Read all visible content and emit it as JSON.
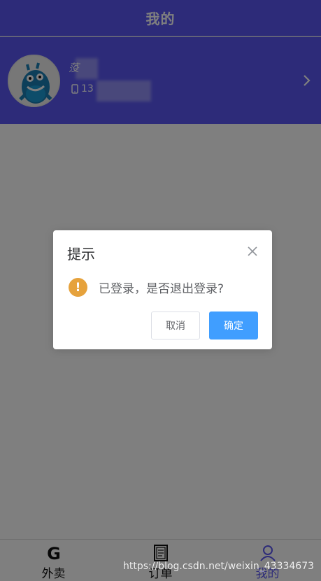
{
  "header": {
    "title": "我的"
  },
  "profile": {
    "name_partial": "莈",
    "phone_partial": "13",
    "avatar": "blue-monster-avatar"
  },
  "tabs": [
    {
      "label": "外卖",
      "icon": "g-letter-icon"
    },
    {
      "label": "订单",
      "icon": "order-document-icon"
    },
    {
      "label": "我的",
      "icon": "user-profile-icon"
    }
  ],
  "dialog": {
    "title": "提示",
    "message": "已登录，是否退出登录?",
    "cancel_label": "取消",
    "confirm_label": "确定"
  },
  "watermark": "https://blog.csdn.net/weixin_43334673",
  "colors": {
    "primary": "#5a57f3",
    "button_primary": "#409eff",
    "warning": "#e6a23c"
  }
}
